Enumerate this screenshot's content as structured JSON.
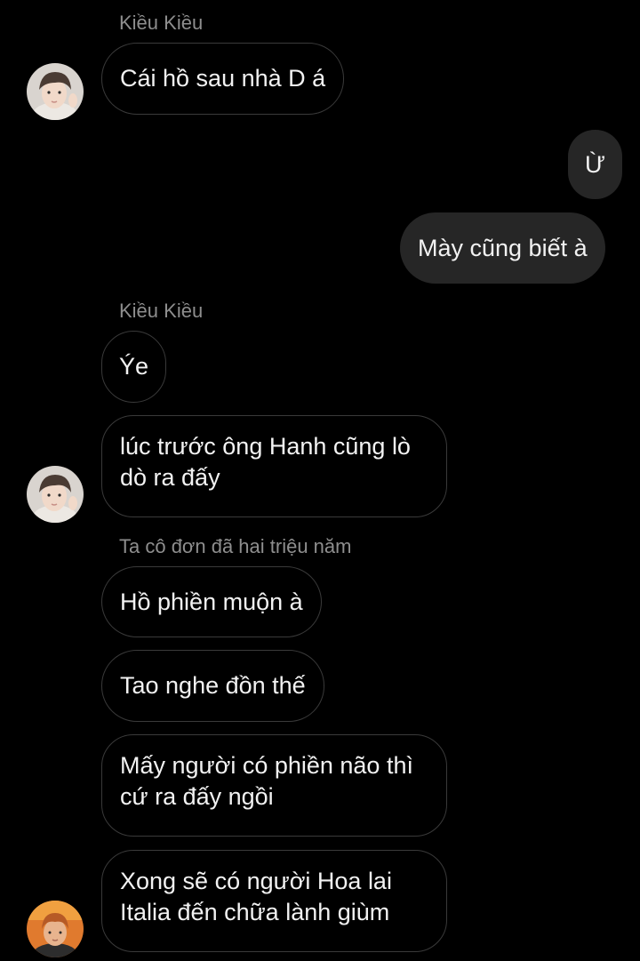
{
  "conversation": {
    "groups": [
      {
        "sender": "Kiều Kiều",
        "messages": [
          "Cái hồ sau nhà D á"
        ]
      },
      {
        "sender": "me",
        "messages": [
          "Ừ",
          "Mày cũng biết à"
        ]
      },
      {
        "sender": "Kiều Kiều",
        "messages": [
          "Ýe",
          "lúc trước ông Hanh cũng lò dò ra đấy"
        ]
      },
      {
        "sender": "Ta cô đơn đã hai triệu năm",
        "messages": [
          "Hồ phiền muộn à",
          "Tao nghe đồn thế",
          "Mấy người có phiền não thì cứ ra đấy ngồi",
          "Xong sẽ có người Hoa lai Italia đến chữa lành giùm"
        ]
      }
    ]
  },
  "colors": {
    "background": "#000000",
    "incoming_bubble_border": "#3a3a3a",
    "outgoing_bubble_bg": "#262626",
    "sender_name": "#8e8e8e",
    "text": "#f2f2f2"
  },
  "icons": {
    "avatar_kieu": "avatar-kieu-kieu",
    "avatar_ta": "avatar-ta-co-don"
  }
}
